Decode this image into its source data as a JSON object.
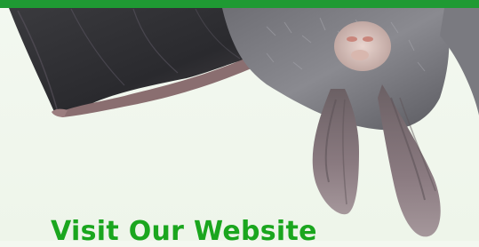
{
  "banner": {
    "link_text": "Visit Our Website",
    "image_subject": "bat",
    "colors": {
      "bar": "#1f9a33",
      "link": "#1aa61e",
      "background": "#f0f6ec"
    }
  }
}
